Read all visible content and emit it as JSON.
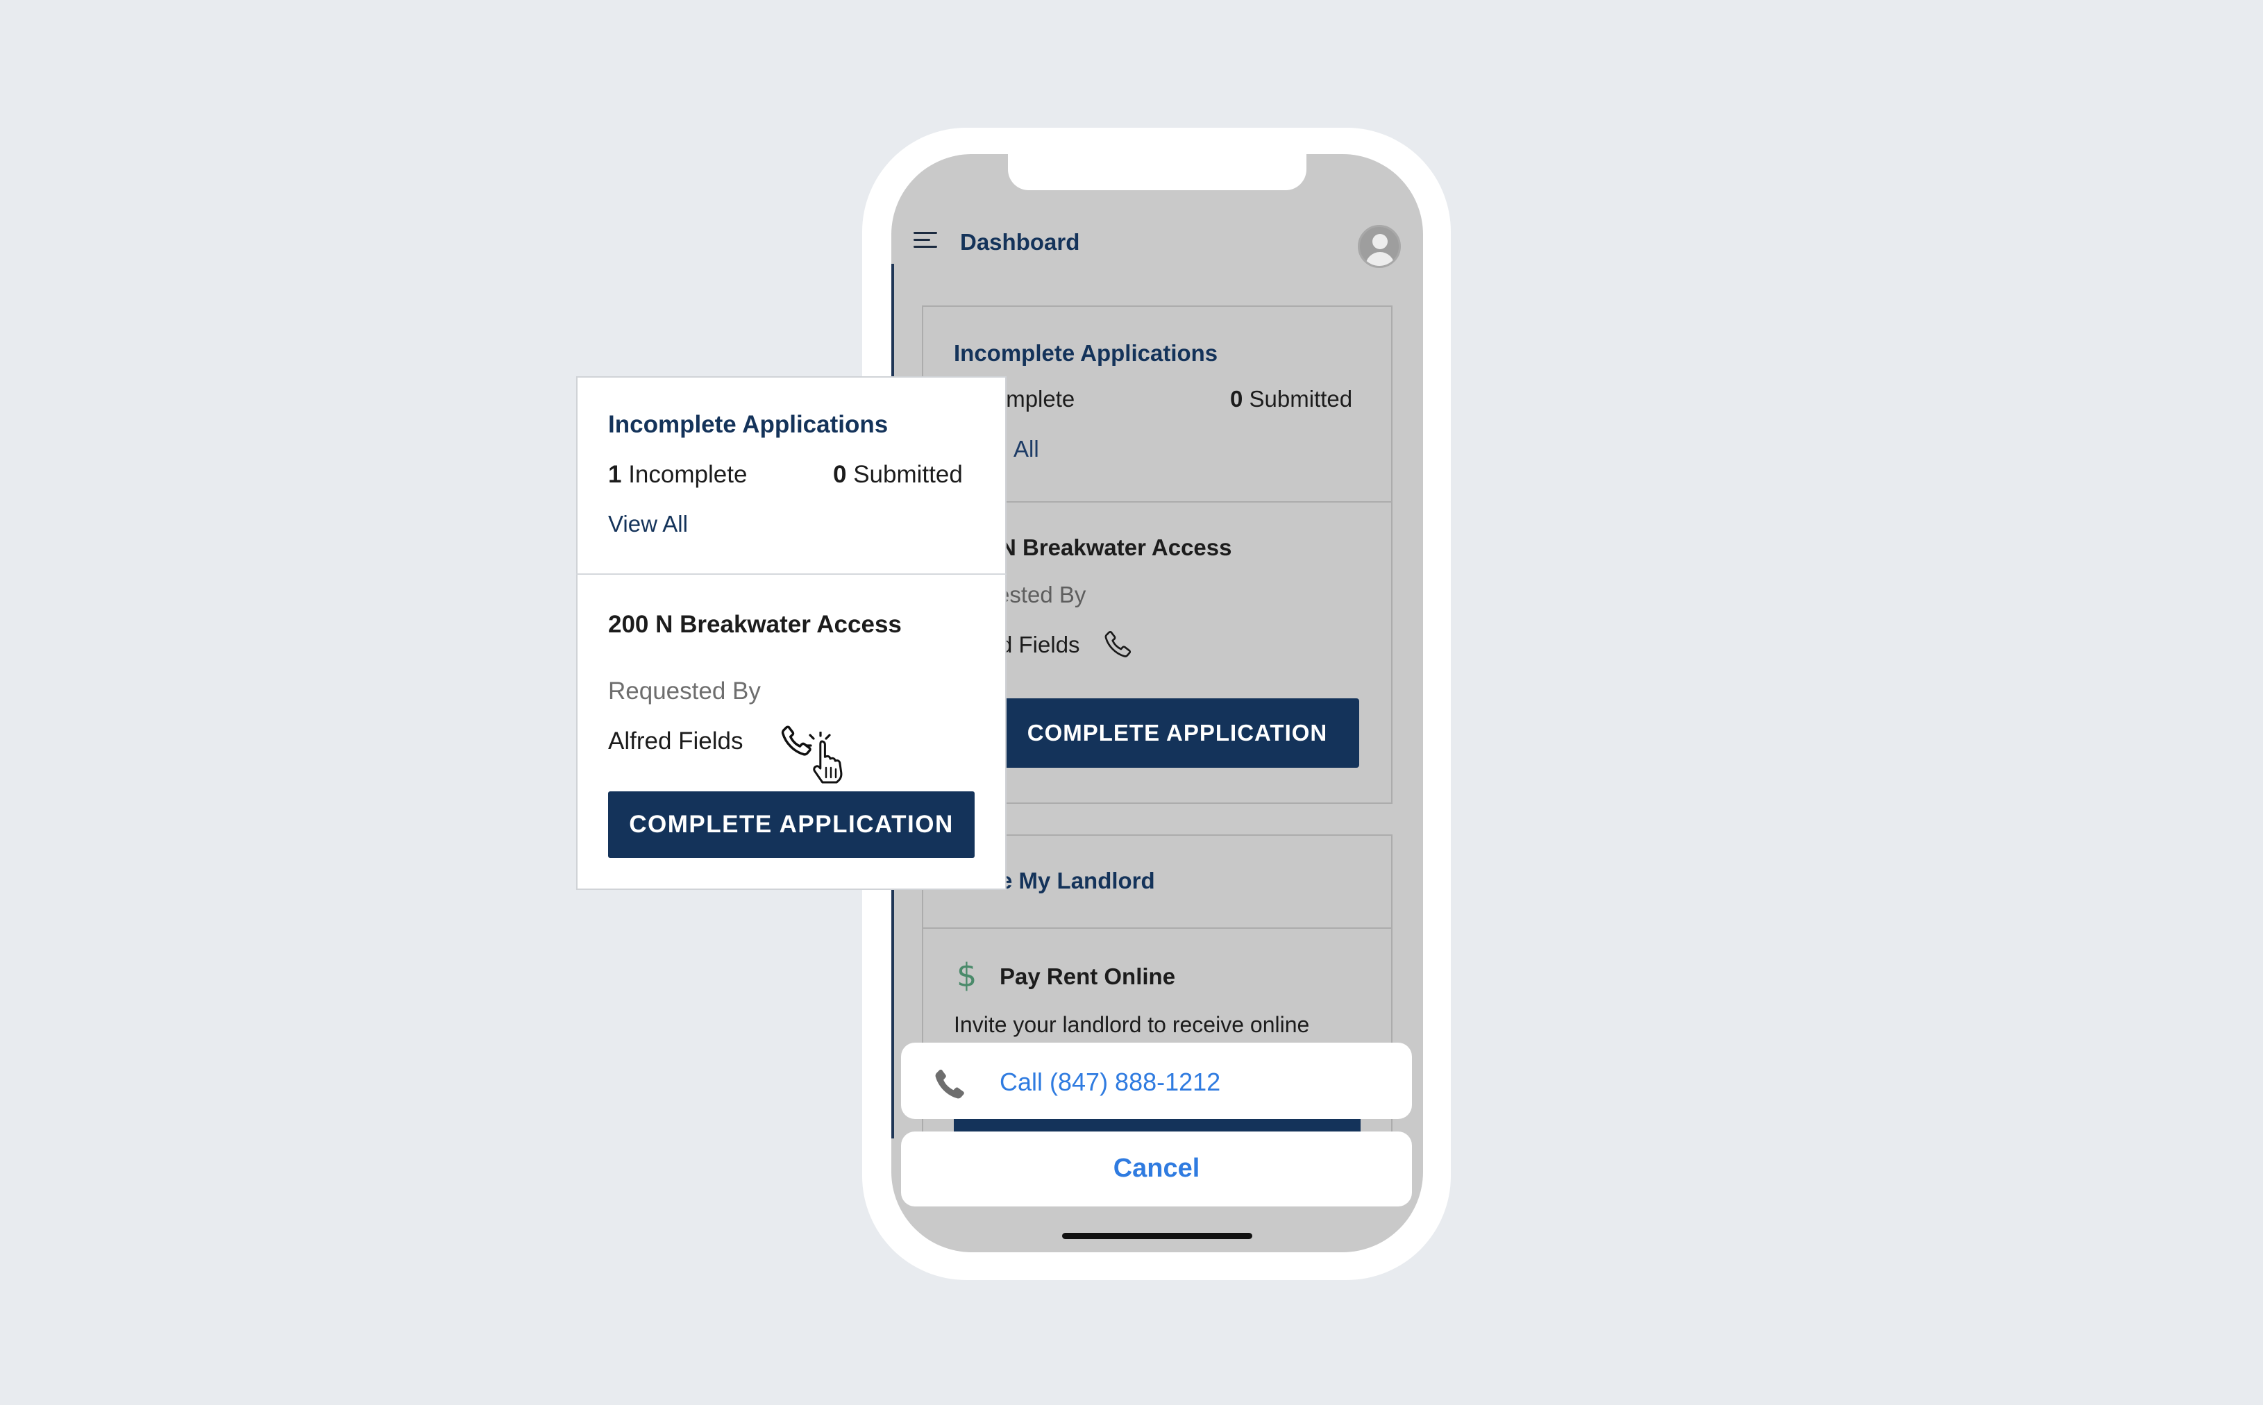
{
  "phone": {
    "header": {
      "menu_icon": "hamburger-icon",
      "title": "Dashboard",
      "avatar_icon": "user-avatar-icon"
    },
    "incomplete_card": {
      "title": "Incomplete Applications",
      "incomplete_visible": "ncomplete",
      "submitted_count": "0",
      "submitted_label": "Submitted",
      "view_all_visible": "All"
    },
    "request_card": {
      "address_visible": "N Breakwater Access",
      "requested_by_visible": "ested By",
      "name_visible": "d Fields",
      "phone_icon": "phone-icon",
      "button_label": "COMPLETE APPLICATION"
    },
    "landlord_card": {
      "title_visible": "e My Landlord",
      "pay_icon": "dollar-icon",
      "pay_title": "Pay Rent Online",
      "pay_text": "Invite your landlord to receive online"
    },
    "action_sheet": {
      "call_icon": "phone-icon",
      "call_label": "Call (847) 888-1212",
      "cancel_label": "Cancel"
    }
  },
  "zoom_card": {
    "title": "Incomplete Applications",
    "incomplete_count": "1",
    "incomplete_label": "Incomplete",
    "submitted_count": "0",
    "submitted_label": "Submitted",
    "view_all": "View All",
    "address": "200 N Breakwater Access",
    "requested_by_label": "Requested By",
    "requester_name": "Alfred Fields",
    "phone_icon": "phone-icon",
    "cursor_icon": "hand-pointer-icon",
    "button_label": "COMPLETE APPLICATION"
  },
  "colors": {
    "background": "#e8ebef",
    "brand_navy": "#14335a",
    "link_blue": "#2f7be0",
    "dollar_green": "#4a8a6a"
  }
}
